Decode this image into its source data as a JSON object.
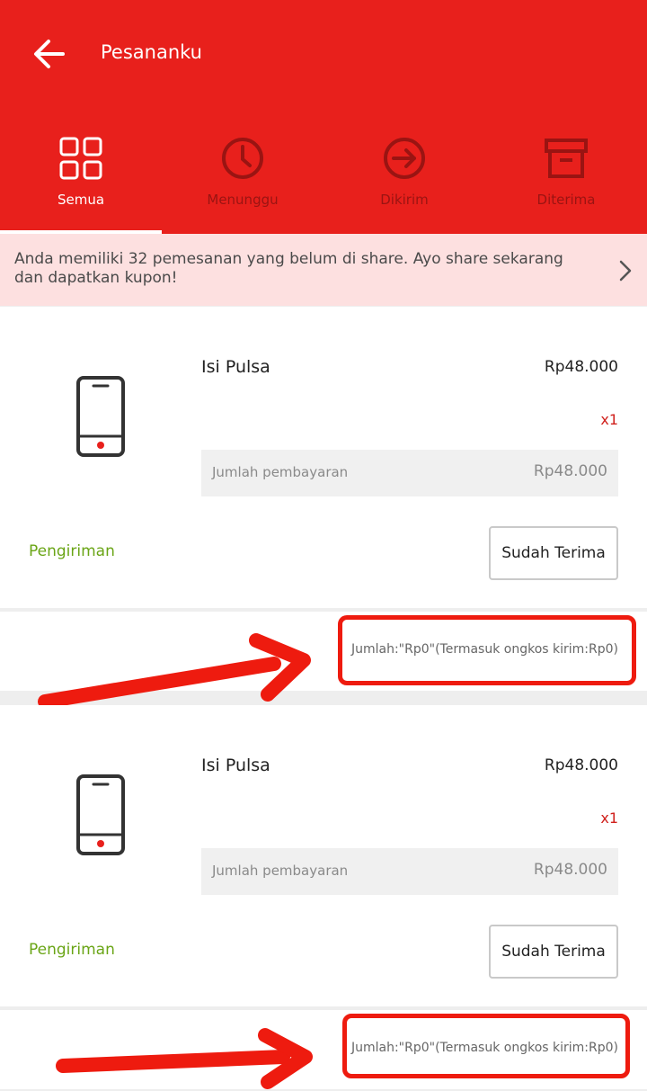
{
  "header": {
    "title": "Pesananku",
    "tabs": [
      {
        "label": "Semua",
        "icon": "grid-icon",
        "active": true
      },
      {
        "label": "Menunggu",
        "icon": "clock-icon",
        "active": false
      },
      {
        "label": "Dikirim",
        "icon": "arrow-circle-icon",
        "active": false
      },
      {
        "label": "Diterima",
        "icon": "archive-box-icon",
        "active": false
      }
    ]
  },
  "banner": {
    "text": "Anda memiliki 32 pemesanan yang belum di share. Ayo share sekarang dan dapatkan kupon!"
  },
  "orders": [
    {
      "name": "Isi Pulsa",
      "price": "Rp48.000",
      "qty": "x1",
      "payment_label": "Jumlah pembayaran",
      "payment_value": "Rp48.000",
      "status": "Pengiriman",
      "action_label": "Sudah Terima",
      "summary": "Jumlah:\"Rp0\"(Termasuk ongkos kirim:Rp0)"
    },
    {
      "name": "Isi Pulsa",
      "price": "Rp48.000",
      "qty": "x1",
      "payment_label": "Jumlah pembayaran",
      "payment_value": "Rp48.000",
      "status": "Pengiriman",
      "action_label": "Sudah Terima",
      "summary": "Jumlah:\"Rp0\"(Termasuk ongkos kirim:Rp0)"
    }
  ],
  "colors": {
    "brand": "#e8201c",
    "banner_bg": "#fde0e0",
    "status": "#6aa516",
    "annotation": "#ee1b0f"
  }
}
